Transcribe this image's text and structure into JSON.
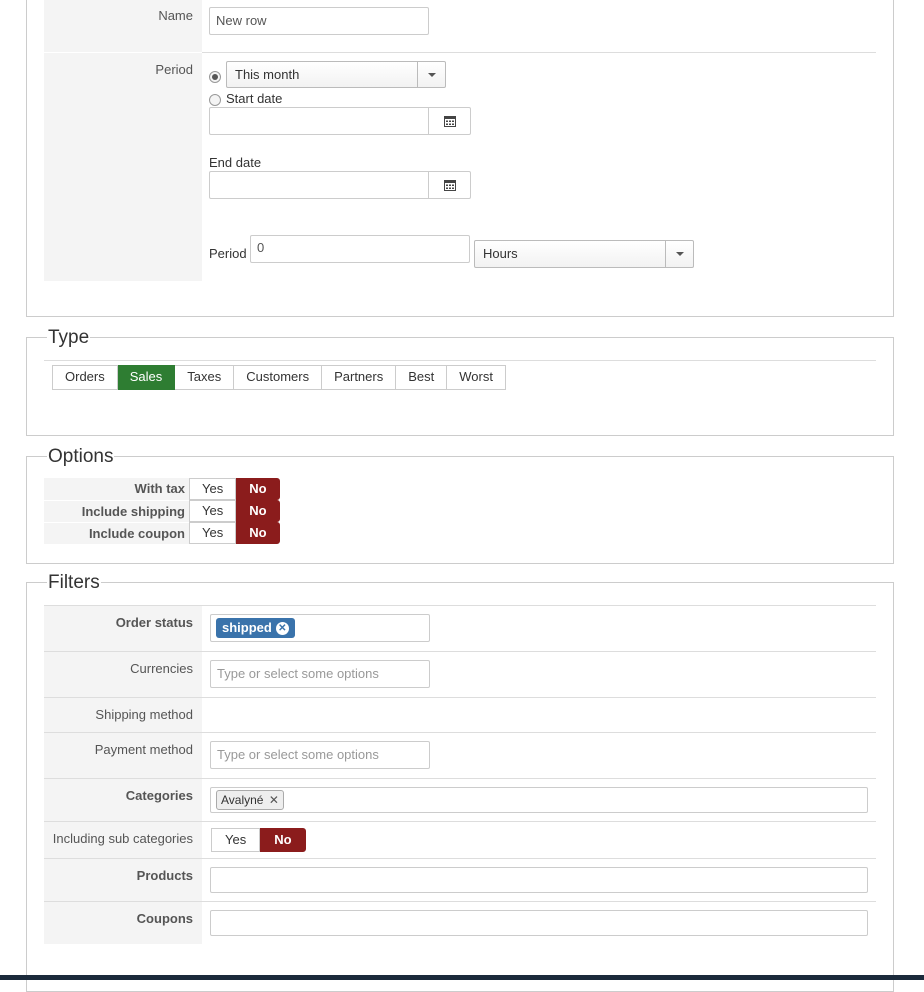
{
  "main_form": {
    "name_label": "Name",
    "name_value": "New row",
    "period_label": "Period",
    "period_select": "This month",
    "start_date_label": "Start date",
    "end_date_label": "End date",
    "period_count_label": "Period",
    "period_count_value": "0",
    "period_unit": "Hours"
  },
  "type": {
    "legend": "Type",
    "tabs": [
      "Orders",
      "Sales",
      "Taxes",
      "Customers",
      "Partners",
      "Best",
      "Worst"
    ],
    "active": "Sales"
  },
  "options": {
    "legend": "Options",
    "rows": [
      {
        "label": "With tax",
        "yes": "Yes",
        "no": "No"
      },
      {
        "label": "Include shipping",
        "yes": "Yes",
        "no": "No"
      },
      {
        "label": "Include coupon",
        "yes": "Yes",
        "no": "No"
      }
    ]
  },
  "filters": {
    "legend": "Filters",
    "order_status_label": "Order status",
    "order_status_tag": "shipped",
    "currencies_label": "Currencies",
    "currencies_placeholder": "Type or select some options",
    "shipping_method_label": "Shipping method",
    "payment_method_label": "Payment method",
    "payment_method_placeholder": "Type or select some options",
    "categories_label": "Categories",
    "categories_tag": "Avalyné",
    "sub_categories_label": "Including sub categories",
    "sub_yes": "Yes",
    "sub_no": "No",
    "products_label": "Products",
    "coupons_label": "Coupons"
  },
  "colors": {
    "active_green": "#2e7d32",
    "no_red": "#8b1c1c",
    "tag_blue": "#3a73ab"
  }
}
